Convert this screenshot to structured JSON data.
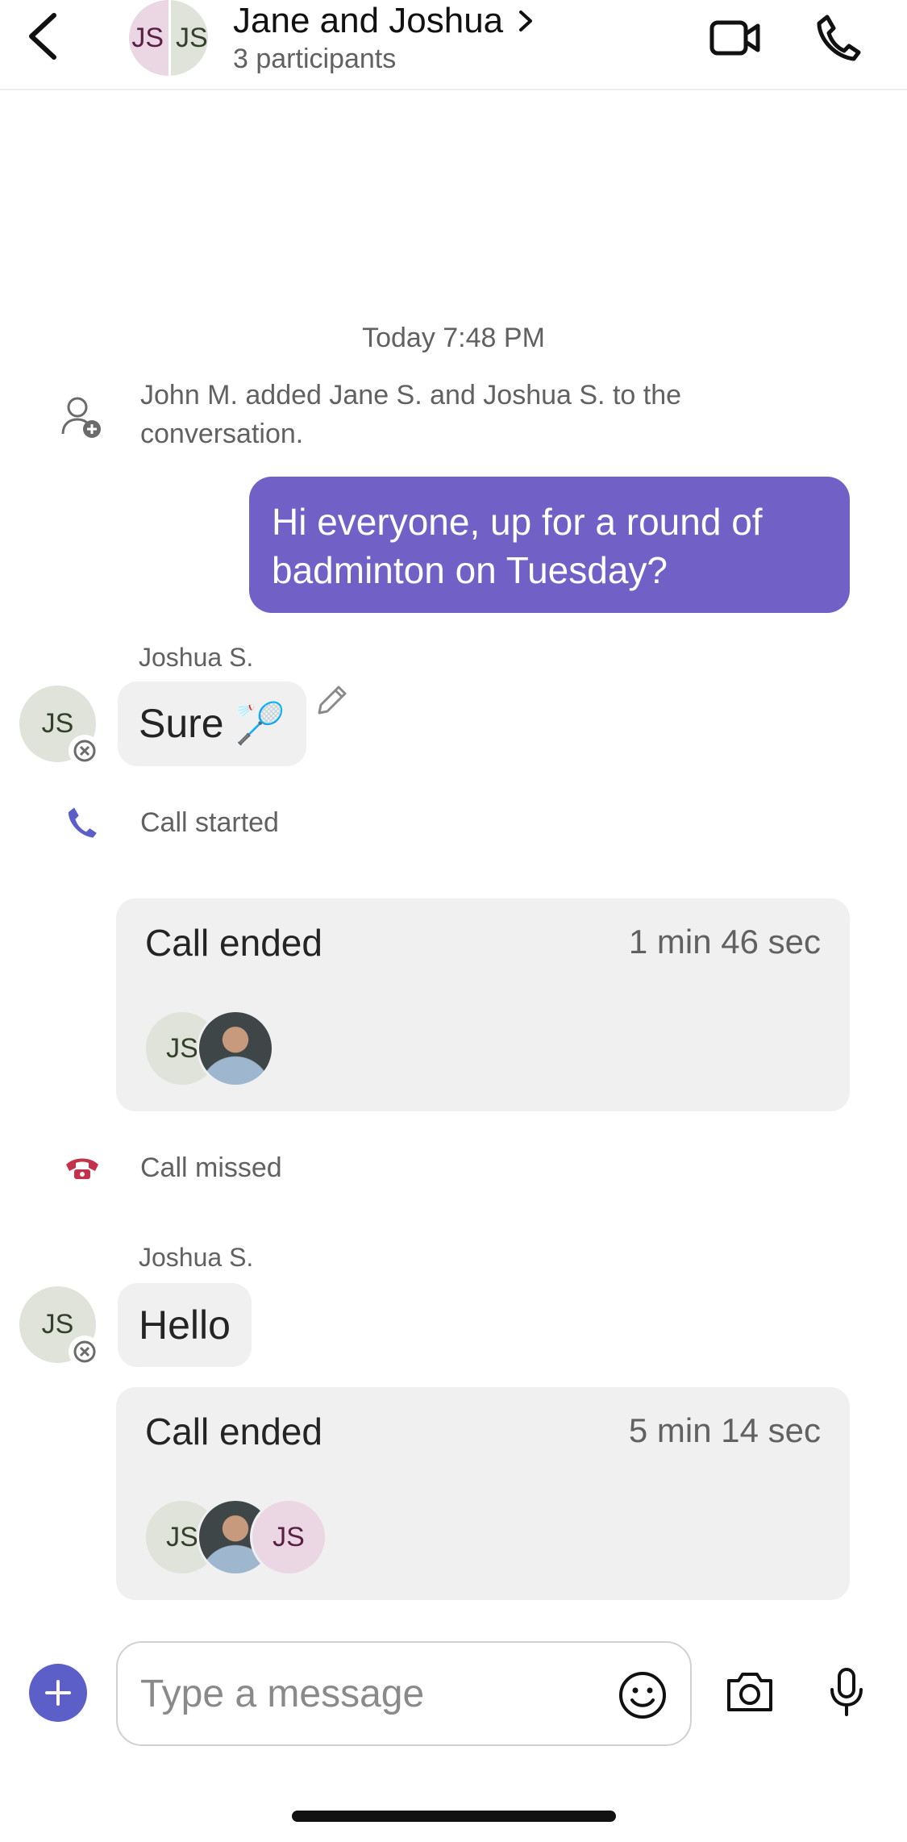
{
  "header": {
    "back_icon": "chevron-left-icon",
    "avatar_left": "JS",
    "avatar_right": "JS",
    "title": "Jane and Joshua",
    "subtitle": "3 participants",
    "video_icon": "video-camera-icon",
    "call_icon": "phone-icon"
  },
  "timeline": {
    "timestamp": "Today 7:48 PM",
    "added_notice": "John M. added Jane S. and Joshua S. to the conversation.",
    "my_message": "Hi everyone, up for a round of badminton on Tuesday?",
    "msg1": {
      "sender": "Joshua S.",
      "initials": "JS",
      "text": "Sure 🏸",
      "edit_icon": "pencil-icon"
    },
    "call_started": "Call started",
    "call1": {
      "title": "Call ended",
      "duration": "1 min 46 sec",
      "p1": "JS"
    },
    "call_missed": "Call missed",
    "msg2": {
      "sender": "Joshua S.",
      "initials": "JS",
      "text": "Hello"
    },
    "call2": {
      "title": "Call ended",
      "duration": "5 min 14 sec",
      "p1": "JS",
      "p3": "JS"
    }
  },
  "composer": {
    "placeholder": "Type a message",
    "plus_icon": "plus-icon",
    "emoji_icon": "emoji-icon",
    "camera_icon": "camera-icon",
    "mic_icon": "microphone-icon"
  },
  "colors": {
    "accent": "#7160c6",
    "button": "#5b5fc7",
    "missed_call": "#c4314b"
  }
}
